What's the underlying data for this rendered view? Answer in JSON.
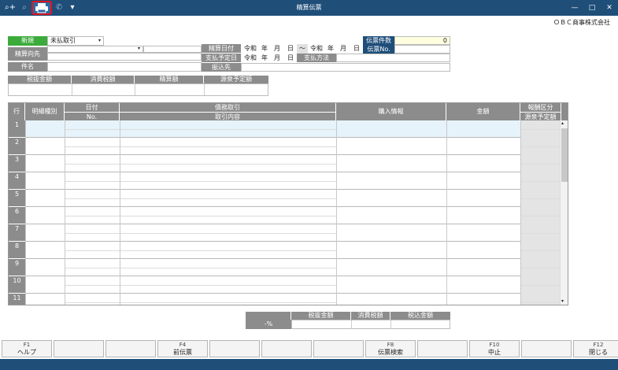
{
  "window": {
    "title": "精算伝票",
    "controls": [
      "—",
      "□",
      "✕"
    ],
    "toolbar_icons": [
      "search-plus-icon",
      "search-minus-icon",
      "print-icon",
      "phone-icon",
      "dropdown-arrow-icon"
    ],
    "toolbar_glyphs": [
      "⌕+",
      "⌕",
      "⎙",
      "✆",
      "▾"
    ]
  },
  "company": "ＯＢＣ商事株式会社",
  "form": {
    "new_label": "新規",
    "type_value": "未払取引",
    "payee_label": "精算向先",
    "subject_label": "件名",
    "settle_date_label": "精算日付",
    "pay_due_label": "支払予定日",
    "transfer_label": "振込先",
    "era": "令和",
    "year": "年",
    "month": "月",
    "day": "日",
    "tilde": "～",
    "pay_method_label": "支払方法",
    "slip_count_label": "伝票件数",
    "slip_count_value": "0",
    "slip_no_label": "伝票No."
  },
  "summary": {
    "headers": [
      "税抜金額",
      "消費税額",
      "精算額",
      "源泉予定額"
    ]
  },
  "table": {
    "row_header": "行",
    "col_detail_type": "明細種別",
    "col_date": "日付",
    "col_no": "No.",
    "col_debt": "債務取引",
    "col_content": "取引内容",
    "col_purchase": "購入情報",
    "col_amount": "金額",
    "col_fee": "報酬区分",
    "col_withhold": "源泉予定額",
    "rows": [
      "1",
      "2",
      "3",
      "4",
      "5",
      "6",
      "7",
      "8",
      "9",
      "10",
      "11"
    ]
  },
  "totals": {
    "tax_rate": "-%",
    "headers": [
      "税抜金額",
      "消費税額",
      "税込金額"
    ]
  },
  "fkeys": [
    {
      "num": "F1",
      "label": "ヘルプ"
    },
    {
      "num": "",
      "label": ""
    },
    {
      "num": "",
      "label": ""
    },
    {
      "num": "F4",
      "label": "前伝票"
    },
    {
      "num": "",
      "label": ""
    },
    {
      "num": "",
      "label": ""
    },
    {
      "num": "",
      "label": ""
    },
    {
      "num": "F8",
      "label": "伝票検索"
    },
    {
      "num": "",
      "label": ""
    },
    {
      "num": "F10",
      "label": "中止"
    },
    {
      "num": "",
      "label": ""
    },
    {
      "num": "F12",
      "label": "閉じる"
    }
  ],
  "colors": {
    "titlebar": "#1f4e79",
    "accent_green": "#3cab3c",
    "header_grey": "#8c8c8c",
    "selected_row": "#e6f3fb",
    "highlight": "#e0141e"
  }
}
